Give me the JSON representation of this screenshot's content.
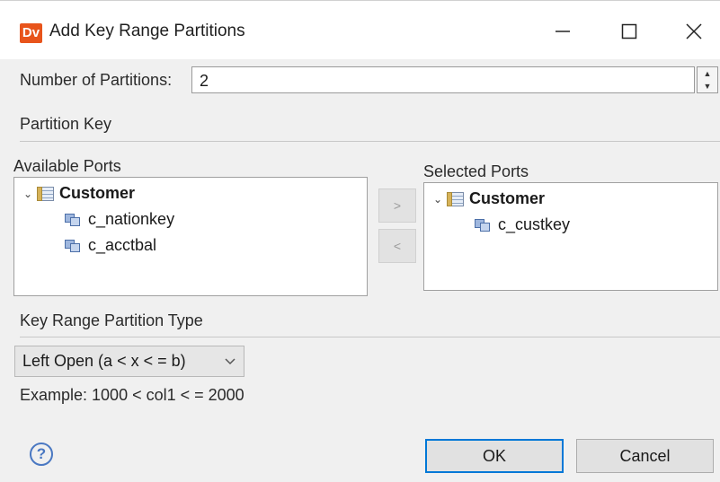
{
  "window": {
    "app_icon": "Dv",
    "title": "Add Key Range Partitions",
    "minimize_icon": "minimize-icon",
    "maximize_icon": "maximize-icon",
    "close_icon": "close-icon"
  },
  "partitions": {
    "label": "Number of  Partitions:",
    "value": "2"
  },
  "partition_key": {
    "heading": "Partition Key"
  },
  "available_ports": {
    "label": "Available Ports",
    "root": "Customer",
    "items": [
      "c_nationkey",
      "c_acctbal"
    ]
  },
  "move": {
    "add": ">",
    "remove": "<"
  },
  "selected_ports": {
    "label": "Selected Ports",
    "root": "Customer",
    "items": [
      "c_custkey"
    ]
  },
  "key_range_type": {
    "heading": "Key Range Partition Type",
    "selected": "Left Open (a < x < = b)",
    "example": "Example: 1000 < col1 < = 2000"
  },
  "footer": {
    "help_icon": "?",
    "ok": "OK",
    "cancel": "Cancel"
  },
  "colors": {
    "accent": "#0078d7",
    "app_icon_bg": "#e8541b",
    "dialog_bg": "#f0f0f0"
  }
}
